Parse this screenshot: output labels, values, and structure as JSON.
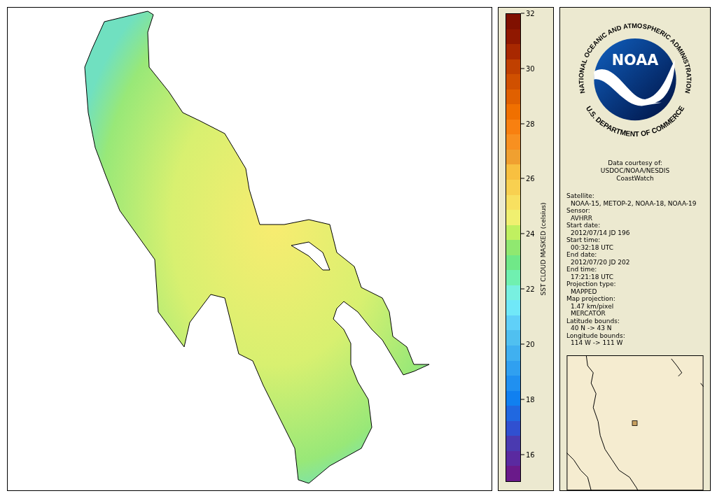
{
  "colorbar": {
    "title": "SST CLOUD MASKED (celsius)",
    "ticks": [
      "32",
      "30",
      "28",
      "26",
      "24",
      "22",
      "20",
      "18",
      "16"
    ]
  },
  "logo": {
    "top_text": "NATIONAL OCEANIC AND ATMOSPHERIC ADMINISTRATION",
    "bottom_text": "U.S. DEPARTMENT OF COMMERCE",
    "center_text": "NOAA"
  },
  "credit": [
    "Data courtesy of:",
    "USDOC/NOAA/NESDIS",
    "CoastWatch"
  ],
  "metadata": [
    {
      "label": "Satellite:",
      "values": [
        "NOAA-15, METOP-2, NOAA-18, NOAA-19"
      ]
    },
    {
      "label": "Sensor:",
      "values": [
        "AVHRR"
      ]
    },
    {
      "label": "Start date:",
      "values": [
        "2012/07/14 JD 196"
      ]
    },
    {
      "label": "Start time:",
      "values": [
        "00:32:18 UTC"
      ]
    },
    {
      "label": "End date:",
      "values": [
        "2012/07/20 JD 202"
      ]
    },
    {
      "label": "End time:",
      "values": [
        "17:21:18 UTC"
      ]
    },
    {
      "label": "Projection type:",
      "values": [
        "MAPPED"
      ]
    },
    {
      "label": "Map projection:",
      "values": [
        "1.47 km/pixel",
        "MERCATOR"
      ]
    },
    {
      "label": "Latitude bounds:",
      "values": [
        "40 N -> 43 N"
      ]
    },
    {
      "label": "Longitude bounds:",
      "values": [
        "114 W -> 111 W"
      ]
    }
  ]
}
